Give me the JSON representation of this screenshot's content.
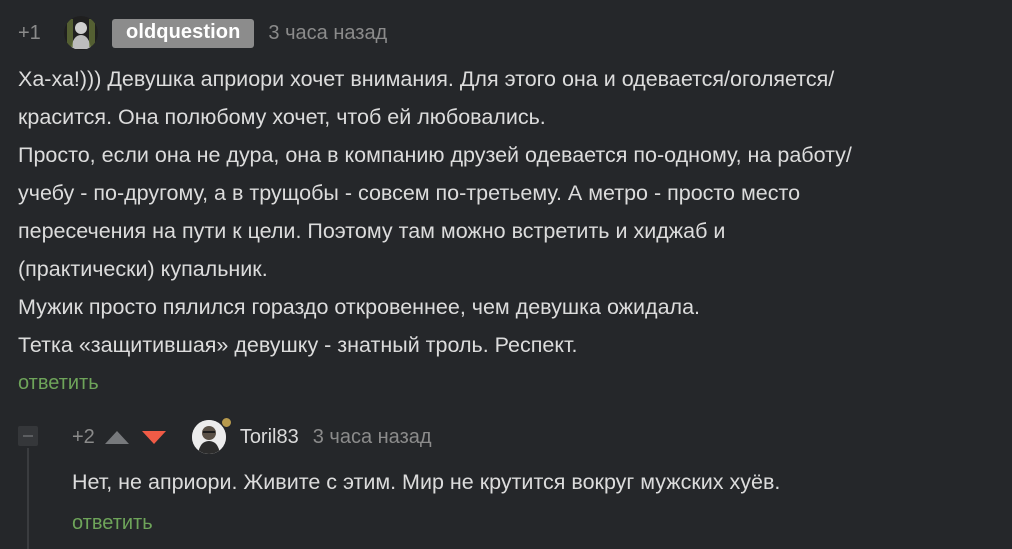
{
  "comment": {
    "rating": "+1",
    "author": "oldquestion",
    "time": "3 часа назад",
    "lines": [
      "Ха-ха!))) Девушка априори хочет внимания. Для этого она и одевается/оголяется/",
      "красится. Она полюбому хочет, чтоб ей любовались.",
      "Просто, если она не дура, она в компанию друзей одевается по-одному, на работу/",
      "учебу - по-другому, а в трущобы - совсем по-третьему. А метро - просто место",
      "пересечения на пути к цели. Поэтому там можно встретить и хиджаб и",
      "(практически) купальник.",
      "Мужик просто пялился гораздо откровеннее, чем девушка ожидала.",
      "Тетка «защитившая» девушку - знатный троль. Респект."
    ],
    "reply_label": "ответить"
  },
  "reply": {
    "rating": "+2",
    "author": "Toril83",
    "time": "3 часа назад",
    "text": "Нет, не априори. Живите с этим. Мир не крутится вокруг мужских хуёв.",
    "reply_label": "ответить"
  },
  "colors": {
    "background": "#25272a",
    "text": "#dcdcdc",
    "muted": "#8b8b8b",
    "reply_link": "#6ea45a",
    "downvote_active": "#f05b46",
    "author_badge": "#8c8c8c"
  },
  "icons": {
    "upvote": "triangle-up-icon",
    "downvote": "triangle-down-icon",
    "collapse": "minus-square-icon"
  }
}
